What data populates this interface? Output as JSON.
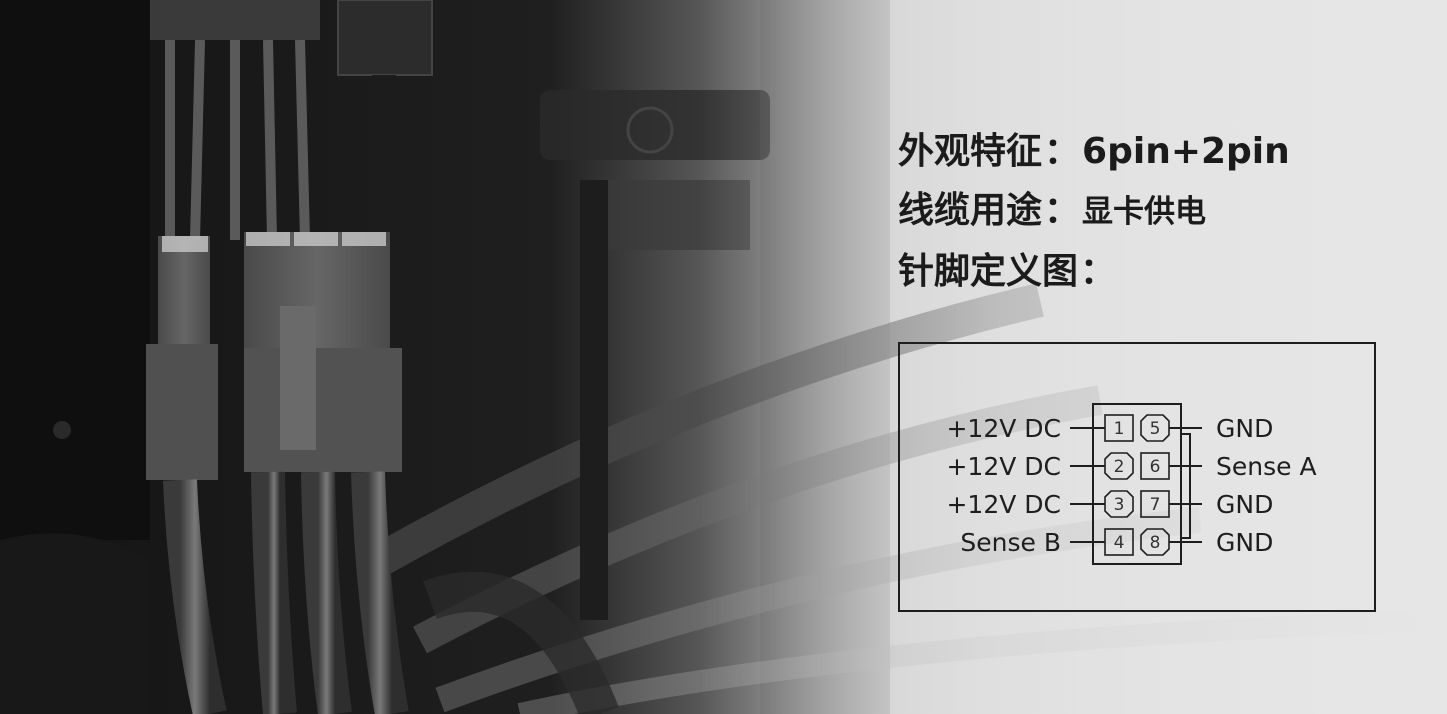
{
  "info": {
    "rows": [
      {
        "label": "外观特征",
        "sep": "：",
        "value": "6pin+2pin"
      },
      {
        "label": "线缆用途",
        "sep": "：",
        "value": "显卡供电"
      },
      {
        "label": "针脚定义图",
        "sep": "：",
        "value": ""
      }
    ]
  },
  "pinout": {
    "left": [
      {
        "pin": "1",
        "label": "+12V DC"
      },
      {
        "pin": "2",
        "label": "+12V DC"
      },
      {
        "pin": "3",
        "label": "+12V DC"
      },
      {
        "pin": "4",
        "label": "Sense B"
      }
    ],
    "right": [
      {
        "pin": "5",
        "label": "GND"
      },
      {
        "pin": "6",
        "label": "Sense A"
      },
      {
        "pin": "7",
        "label": "GND"
      },
      {
        "pin": "8",
        "label": "GND"
      }
    ]
  },
  "colors": {
    "text": "#1b1b1b",
    "background_dark": "#151515",
    "background_light": "#e4e4e4",
    "connector": "#5c5c5c"
  }
}
